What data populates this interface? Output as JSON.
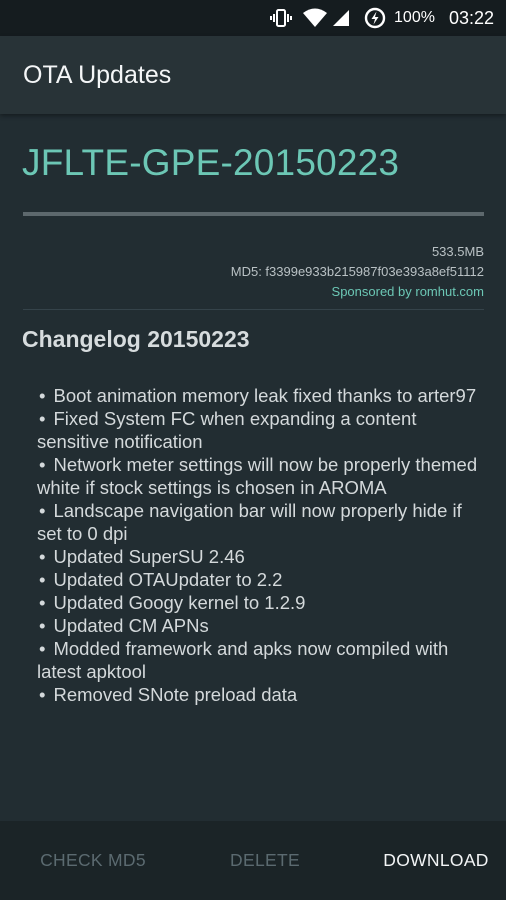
{
  "status_bar": {
    "battery": "100%",
    "time": "03:22",
    "icons": [
      "vibrate-icon",
      "wifi-icon",
      "signal-icon",
      "battery-saver-icon"
    ]
  },
  "app_bar": {
    "title": "OTA Updates"
  },
  "update": {
    "version": "JFLTE-GPE-20150223",
    "progress": 0,
    "size": "533.5MB",
    "md5": "MD5: f3399e933b215987f03e393a8ef51112",
    "sponsor": "Sponsored by romhut.com"
  },
  "changelog": {
    "title": "Changelog 20150223",
    "bullet": "•",
    "items": [
      "Boot animation memory leak fixed thanks to arter97",
      "Fixed System FC when expanding a content sensitive notification",
      "Network meter settings will now be properly themed white if stock settings is chosen in AROMA",
      "Landscape navigation bar will now properly hide if set to 0 dpi",
      "Updated SuperSU 2.46",
      "Updated OTAUpdater to 2.2",
      "Updated Googy kernel to 1.2.9",
      "Updated CM APNs",
      "Modded framework and apks now compiled with latest apktool",
      "Removed SNote preload data"
    ]
  },
  "actions": {
    "check_md5": "CHECK MD5",
    "delete": "DELETE",
    "download": "DOWNLOAD"
  },
  "colors": {
    "accent": "#6cc7b5",
    "background": "#222d32",
    "app_bar": "#283337",
    "status_bar": "#151c1f",
    "disabled_button": "#5b6a70"
  }
}
